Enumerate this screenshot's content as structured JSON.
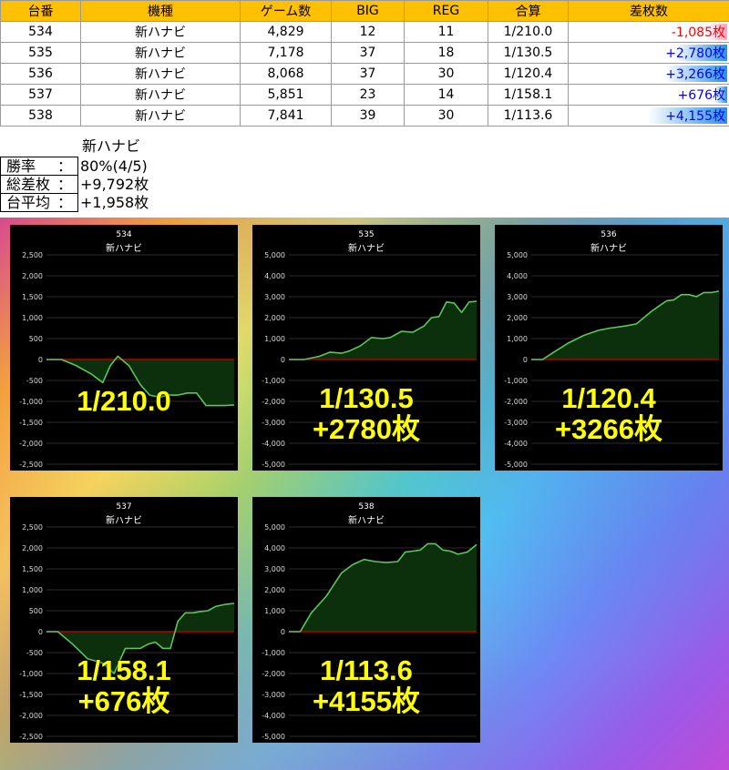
{
  "table": {
    "headers": [
      "台番",
      "機種",
      "ゲーム数",
      "BIG",
      "REG",
      "合算",
      "差枚数"
    ],
    "rows": [
      {
        "machine": "534",
        "model": "新ハナビ",
        "games": "4,829",
        "big": "12",
        "reg": "11",
        "combined": "1/210.0",
        "diff": "-1,085枚",
        "diff_value": -1085
      },
      {
        "machine": "535",
        "model": "新ハナビ",
        "games": "7,178",
        "big": "37",
        "reg": "18",
        "combined": "1/130.5",
        "diff": "+2,780枚",
        "diff_value": 2780
      },
      {
        "machine": "536",
        "model": "新ハナビ",
        "games": "8,068",
        "big": "37",
        "reg": "30",
        "combined": "1/120.4",
        "diff": "+3,266枚",
        "diff_value": 3266
      },
      {
        "machine": "537",
        "model": "新ハナビ",
        "games": "5,851",
        "big": "23",
        "reg": "14",
        "combined": "1/158.1",
        "diff": "+676枚",
        "diff_value": 676
      },
      {
        "machine": "538",
        "model": "新ハナビ",
        "games": "7,841",
        "big": "39",
        "reg": "30",
        "combined": "1/113.6",
        "diff": "+4,155枚",
        "diff_value": 4155
      }
    ]
  },
  "summary": {
    "title": "新ハナビ",
    "win_rate_label": "勝率",
    "win_rate": "80%(4/5)",
    "total_diff_label": "総差枚",
    "total_diff": "+9,792枚",
    "average_label": "台平均",
    "average": "+1,958枚",
    "colon": "："
  },
  "colors": {
    "header_bg": "#ffc000",
    "negative_text": "#ff0000",
    "positive_text": "#0000ff",
    "line": "#5ec45e",
    "area_fill": "#0c2f0c",
    "zero_line": "#c00000",
    "overlay_text": "#ffff00"
  },
  "chart_data": [
    {
      "type": "area",
      "id": "534",
      "title": "新ハナビ",
      "ylim": [
        -2500,
        2500
      ],
      "yticks": [
        2500,
        2000,
        1500,
        1000,
        500,
        0,
        -500,
        -1000,
        -1500,
        -2000,
        -2500
      ],
      "ytick_labels": [
        "2,500",
        "2,000",
        "1,500",
        "1,000",
        "500",
        "0",
        "-500",
        "-1,000",
        "-1,500",
        "-2,000",
        "-2,500"
      ],
      "x": [
        0,
        0.08,
        0.16,
        0.24,
        0.3,
        0.34,
        0.38,
        0.44,
        0.5,
        0.55,
        0.6,
        0.65,
        0.7,
        0.75,
        0.8,
        0.85,
        0.9,
        0.95,
        1.0
      ],
      "y": [
        0,
        0,
        -150,
        -350,
        -550,
        -150,
        80,
        -150,
        -600,
        -850,
        -900,
        -850,
        -850,
        -800,
        -800,
        -1100,
        -1100,
        -1100,
        -1085
      ],
      "overlay": [
        "1/210.0"
      ]
    },
    {
      "type": "area",
      "id": "535",
      "title": "新ハナビ",
      "ylim": [
        -5000,
        5000
      ],
      "yticks": [
        5000,
        4000,
        3000,
        2000,
        1000,
        0,
        -1000,
        -2000,
        -3000,
        -4000,
        -5000
      ],
      "ytick_labels": [
        "5,000",
        "4,000",
        "3,000",
        "2,000",
        "1,000",
        "0",
        "-1,000",
        "-2,000",
        "-3,000",
        "-4,000",
        "-5,000"
      ],
      "x": [
        0,
        0.08,
        0.16,
        0.22,
        0.28,
        0.32,
        0.38,
        0.44,
        0.5,
        0.54,
        0.6,
        0.66,
        0.72,
        0.76,
        0.8,
        0.84,
        0.88,
        0.92,
        0.96,
        1.0
      ],
      "y": [
        0,
        0,
        150,
        350,
        300,
        400,
        650,
        1050,
        1000,
        1050,
        1350,
        1300,
        1600,
        2000,
        2050,
        2750,
        2700,
        2250,
        2750,
        2780
      ],
      "overlay": [
        "1/130.5",
        "+2780枚"
      ]
    },
    {
      "type": "area",
      "id": "536",
      "title": "新ハナビ",
      "ylim": [
        -5000,
        5000
      ],
      "yticks": [
        5000,
        4000,
        3000,
        2000,
        1000,
        0,
        -1000,
        -2000,
        -3000,
        -4000,
        -5000
      ],
      "ytick_labels": [
        "5,000",
        "4,000",
        "3,000",
        "2,000",
        "1,000",
        "0",
        "-1,000",
        "-2,000",
        "-3,000",
        "-4,000",
        "-5,000"
      ],
      "x": [
        0,
        0.06,
        0.12,
        0.2,
        0.28,
        0.36,
        0.42,
        0.5,
        0.56,
        0.6,
        0.64,
        0.68,
        0.72,
        0.76,
        0.8,
        0.84,
        0.88,
        0.92,
        0.96,
        1.0
      ],
      "y": [
        0,
        0,
        350,
        800,
        1150,
        1400,
        1500,
        1600,
        1700,
        2000,
        2300,
        2550,
        2800,
        2850,
        3100,
        3100,
        3000,
        3200,
        3200,
        3266
      ],
      "overlay": [
        "1/120.4",
        "+3266枚"
      ]
    },
    {
      "type": "area",
      "id": "537",
      "title": "新ハナビ",
      "ylim": [
        -2500,
        2500
      ],
      "yticks": [
        2500,
        2000,
        1500,
        1000,
        500,
        0,
        -500,
        -1000,
        -1500,
        -2000,
        -2500
      ],
      "ytick_labels": [
        "2,500",
        "2,000",
        "1,500",
        "1,000",
        "500",
        "0",
        "-500",
        "-1,000",
        "-1,500",
        "-2,000",
        "-2,500"
      ],
      "x": [
        0,
        0.06,
        0.14,
        0.22,
        0.3,
        0.36,
        0.42,
        0.5,
        0.54,
        0.58,
        0.62,
        0.66,
        0.7,
        0.74,
        0.78,
        0.82,
        0.86,
        0.9,
        0.95,
        1.0
      ],
      "y": [
        0,
        0,
        -300,
        -650,
        -750,
        -1000,
        -400,
        -400,
        -300,
        -250,
        -400,
        -400,
        250,
        450,
        450,
        480,
        500,
        600,
        650,
        676
      ],
      "overlay": [
        "1/158.1",
        "+676枚"
      ]
    },
    {
      "type": "area",
      "id": "538",
      "title": "新ハナビ",
      "ylim": [
        -5000,
        5000
      ],
      "yticks": [
        5000,
        4000,
        3000,
        2000,
        1000,
        0,
        -1000,
        -2000,
        -3000,
        -4000,
        -5000
      ],
      "ytick_labels": [
        "5,000",
        "4,000",
        "3,000",
        "2,000",
        "1,000",
        "0",
        "-1,000",
        "-2,000",
        "-3,000",
        "-4,000",
        "-5,000"
      ],
      "x": [
        0,
        0.06,
        0.12,
        0.2,
        0.28,
        0.34,
        0.4,
        0.46,
        0.52,
        0.58,
        0.62,
        0.66,
        0.7,
        0.74,
        0.78,
        0.82,
        0.86,
        0.9,
        0.95,
        1.0
      ],
      "y": [
        0,
        0,
        900,
        1700,
        2800,
        3200,
        3450,
        3350,
        3300,
        3350,
        3800,
        3850,
        3900,
        4200,
        4200,
        3900,
        3850,
        3700,
        3800,
        4155
      ],
      "overlay": [
        "1/113.6",
        "+4155枚"
      ]
    }
  ]
}
